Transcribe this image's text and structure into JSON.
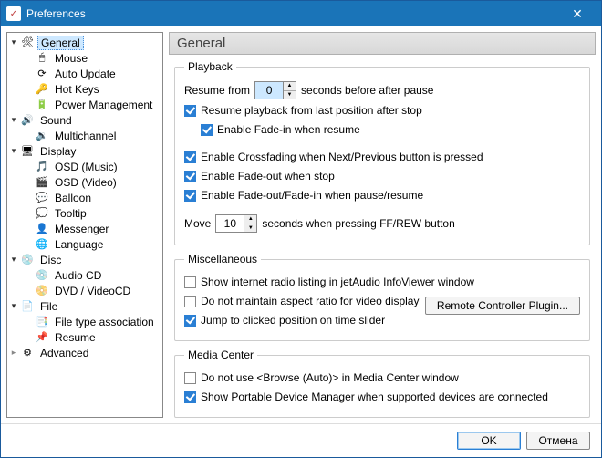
{
  "window": {
    "title": "Preferences"
  },
  "tree": {
    "general": "General",
    "mouse": "Mouse",
    "autoUpdate": "Auto Update",
    "hotkeys": "Hot Keys",
    "power": "Power Management",
    "sound": "Sound",
    "multichannel": "Multichannel",
    "display": "Display",
    "osdMusic": "OSD (Music)",
    "osdVideo": "OSD (Video)",
    "balloon": "Balloon",
    "tooltip": "Tooltip",
    "messenger": "Messenger",
    "language": "Language",
    "disc": "Disc",
    "audioCD": "Audio CD",
    "dvd": "DVD / VideoCD",
    "file": "File",
    "fileAssoc": "File type association",
    "resume": "Resume",
    "advanced": "Advanced"
  },
  "header": "General",
  "playback": {
    "legend": "Playback",
    "resumeFromPre": "Resume from",
    "resumeFromVal": "0",
    "resumeFromPost": "seconds before after pause",
    "resumeLast": "Resume playback from last position after stop",
    "fadein": "Enable Fade-in when resume",
    "crossfade": "Enable Crossfading when Next/Previous button is pressed",
    "fadeoutStop": "Enable Fade-out when stop",
    "fadePause": "Enable Fade-out/Fade-in when pause/resume",
    "movePre": "Move",
    "moveVal": "10",
    "movePost": "seconds when pressing FF/REW button"
  },
  "misc": {
    "legend": "Miscellaneous",
    "radio": "Show internet radio listing in jetAudio InfoViewer window",
    "aspect": "Do not maintain aspect ratio for video display",
    "jump": "Jump to clicked position on time slider",
    "remote": "Remote Controller Plugin..."
  },
  "media": {
    "legend": "Media Center",
    "noBrowse": "Do not use <Browse (Auto)> in Media Center window",
    "portable": "Show Portable Device Manager when supported devices are connected"
  },
  "buttons": {
    "ok": "OK",
    "cancel": "Отмена"
  }
}
